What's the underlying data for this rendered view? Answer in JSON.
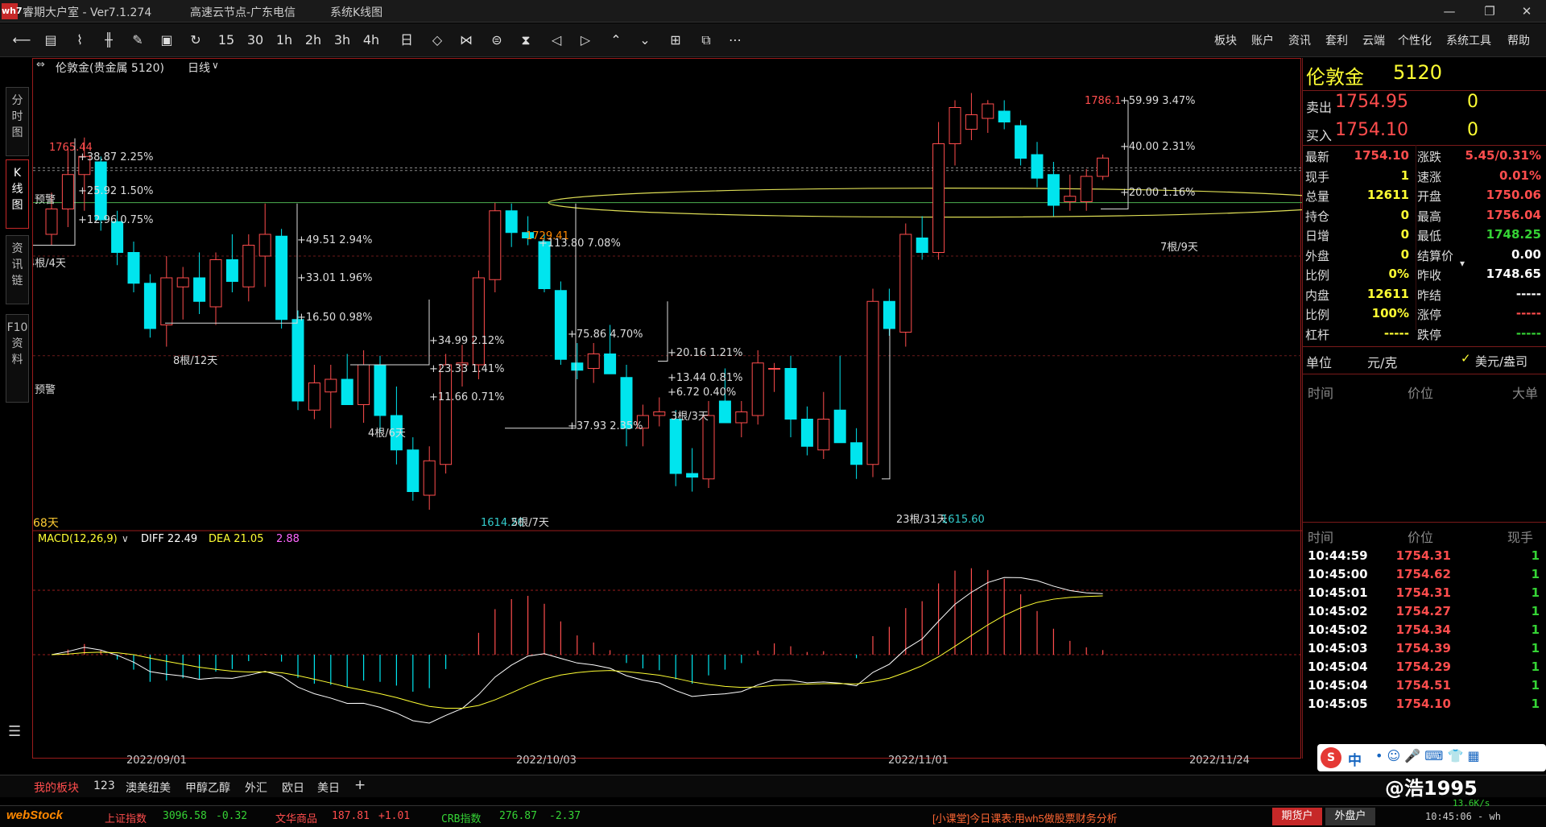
{
  "window": {
    "logo": "wh7",
    "app_title": "睿期大户室  - Ver7.1.274",
    "server": "高速云节点-广东电信",
    "module": "系统K线图",
    "minimize": "—",
    "maximize": "❐",
    "close": "✕"
  },
  "toolbar": {
    "icons": [
      "back-arrow-icon",
      "table-icon",
      "line-chart-icon",
      "kline-icon",
      "draw-icon",
      "save-icon",
      "refresh-icon",
      "15",
      "30",
      "1h",
      "2h",
      "3h",
      "4h",
      "day-icon",
      "diamond-icon",
      "bowtie-icon",
      "layers-icon",
      "hourglass-icon",
      "prev-icon",
      "next-icon",
      "up-icon",
      "down-icon",
      "grid-icon",
      "window-icon",
      "more-icon"
    ],
    "timeframes": [
      "15",
      "30",
      "1h",
      "2h",
      "3h",
      "4h"
    ],
    "menu": [
      "板块",
      "账户",
      "资讯",
      "套利",
      "云端",
      "个性化",
      "系统工具",
      "帮助"
    ]
  },
  "side_tabs": [
    {
      "label": "分\n时\n图",
      "active": false
    },
    {
      "label": "K\n线\n图",
      "active": true
    },
    {
      "label": "资\n讯\n链",
      "active": false
    },
    {
      "label": "F10\n资\n料",
      "active": false
    }
  ],
  "chart": {
    "header_symbol": "伦敦金(贵金属 5120)",
    "period": "日线",
    "period_arrow": "∨",
    "warn1": "预警",
    "warn2": "预警",
    "days_label": "68天",
    "macd_label": "MACD(12,26,9)",
    "macd_arrow": "∨",
    "diff": "DIFF 22.49",
    "dea": "DEA 21.05",
    "macd_val": "2.88",
    "dates": [
      "2022/09/01",
      "2022/10/03",
      "2022/11/01",
      "2022/11/24"
    ],
    "annotations": [
      {
        "text": "1765.44",
        "color": "#ff4d4d"
      },
      {
        "text": "+38.87  2.25%",
        "color": "#ddd"
      },
      {
        "text": "+25.92  1.50%",
        "color": "#ddd"
      },
      {
        "text": "+12.96  0.75%",
        "color": "#ddd"
      },
      {
        "text": "4根/4天",
        "color": "#ddd"
      },
      {
        "text": "+49.51  2.94%",
        "color": "#ddd"
      },
      {
        "text": "+33.01  1.96%",
        "color": "#ddd"
      },
      {
        "text": "+16.50  0.98%",
        "color": "#ddd"
      },
      {
        "text": "8根/12天",
        "color": "#ddd"
      },
      {
        "text": "+34.99  2.12%",
        "color": "#ddd"
      },
      {
        "text": "+23.33  1.41%",
        "color": "#ddd"
      },
      {
        "text": "+11.66  0.71%",
        "color": "#ddd"
      },
      {
        "text": "4根/6天",
        "color": "#ddd"
      },
      {
        "text": "1614.20",
        "color": "#33cccc"
      },
      {
        "text": "5根/7天",
        "color": "#ddd"
      },
      {
        "text": "1729.41",
        "color": "#ff8800"
      },
      {
        "text": "+113.80  7.08%",
        "color": "#ddd"
      },
      {
        "text": "+75.86  4.70%",
        "color": "#ddd"
      },
      {
        "text": "+37.93  2.35%",
        "color": "#ddd"
      },
      {
        "text": "+20.16  1.21%",
        "color": "#ddd"
      },
      {
        "text": "+13.44  0.81%",
        "color": "#ddd"
      },
      {
        "text": "+6.72  0.40%",
        "color": "#ddd"
      },
      {
        "text": "3根/3天",
        "color": "#ddd"
      },
      {
        "text": "23根/31天",
        "color": "#ddd"
      },
      {
        "text": "1615.60",
        "color": "#33cccc"
      },
      {
        "text": "1786.1",
        "color": "#ff4d4d"
      },
      {
        "text": "+59.99  3.47%",
        "color": "#ddd"
      },
      {
        "text": "+40.00  2.31%",
        "color": "#ddd"
      },
      {
        "text": "+20.00  1.16%",
        "color": "#ddd"
      },
      {
        "text": "7根/9天",
        "color": "#ddd"
      }
    ]
  },
  "chart_data": {
    "type": "candlestick",
    "title": "伦敦金 日线",
    "candles": [
      {
        "o": 1712,
        "h": 1735,
        "l": 1706,
        "c": 1726
      },
      {
        "o": 1726,
        "h": 1760,
        "l": 1716,
        "c": 1745
      },
      {
        "o": 1745,
        "h": 1765.44,
        "l": 1725,
        "c": 1755
      },
      {
        "o": 1752,
        "h": 1755,
        "l": 1714,
        "c": 1720
      },
      {
        "o": 1719,
        "h": 1725,
        "l": 1695,
        "c": 1702
      },
      {
        "o": 1702,
        "h": 1708,
        "l": 1680,
        "c": 1685
      },
      {
        "o": 1685,
        "h": 1690,
        "l": 1655,
        "c": 1660
      },
      {
        "o": 1662,
        "h": 1700,
        "l": 1650,
        "c": 1688
      },
      {
        "o": 1683,
        "h": 1694,
        "l": 1665,
        "c": 1688
      },
      {
        "o": 1688,
        "h": 1702,
        "l": 1668,
        "c": 1675
      },
      {
        "o": 1672,
        "h": 1702,
        "l": 1662,
        "c": 1698
      },
      {
        "o": 1698,
        "h": 1712,
        "l": 1680,
        "c": 1686
      },
      {
        "o": 1683,
        "h": 1712,
        "l": 1675,
        "c": 1706
      },
      {
        "o": 1700,
        "h": 1729,
        "l": 1683,
        "c": 1712
      },
      {
        "o": 1711,
        "h": 1715,
        "l": 1660,
        "c": 1665
      },
      {
        "o": 1665,
        "h": 1670,
        "l": 1615,
        "c": 1620
      },
      {
        "o": 1615,
        "h": 1640,
        "l": 1610,
        "c": 1630
      },
      {
        "o": 1625,
        "h": 1640,
        "l": 1605,
        "c": 1632
      },
      {
        "o": 1632,
        "h": 1646,
        "l": 1618,
        "c": 1618
      },
      {
        "o": 1618,
        "h": 1648,
        "l": 1608,
        "c": 1640
      },
      {
        "o": 1640,
        "h": 1645,
        "l": 1603,
        "c": 1612
      },
      {
        "o": 1612,
        "h": 1628,
        "l": 1585,
        "c": 1593
      },
      {
        "o": 1593,
        "h": 1600,
        "l": 1565,
        "c": 1570
      },
      {
        "o": 1568,
        "h": 1595,
        "l": 1560,
        "c": 1587
      },
      {
        "o": 1585,
        "h": 1646,
        "l": 1580,
        "c": 1640
      },
      {
        "o": 1640,
        "h": 1651,
        "l": 1628,
        "c": 1641
      },
      {
        "o": 1640,
        "h": 1692,
        "l": 1632,
        "c": 1688
      },
      {
        "o": 1687,
        "h": 1729.41,
        "l": 1680,
        "c": 1725
      },
      {
        "o": 1725,
        "h": 1729,
        "l": 1705,
        "c": 1713
      },
      {
        "o": 1713,
        "h": 1722,
        "l": 1706,
        "c": 1710
      },
      {
        "o": 1708,
        "h": 1712,
        "l": 1680,
        "c": 1682
      },
      {
        "o": 1681,
        "h": 1686,
        "l": 1640,
        "c": 1643
      },
      {
        "o": 1641,
        "h": 1652,
        "l": 1632,
        "c": 1637
      },
      {
        "o": 1638,
        "h": 1652,
        "l": 1630,
        "c": 1646
      },
      {
        "o": 1646,
        "h": 1662,
        "l": 1640,
        "c": 1635
      },
      {
        "o": 1633,
        "h": 1640,
        "l": 1595,
        "c": 1605
      },
      {
        "o": 1605,
        "h": 1618,
        "l": 1595,
        "c": 1612
      },
      {
        "o": 1612,
        "h": 1622,
        "l": 1606,
        "c": 1614
      },
      {
        "o": 1610,
        "h": 1615,
        "l": 1573,
        "c": 1580
      },
      {
        "o": 1580,
        "h": 1594,
        "l": 1570,
        "c": 1578
      },
      {
        "o": 1577,
        "h": 1620,
        "l": 1572,
        "c": 1612
      },
      {
        "o": 1620,
        "h": 1638,
        "l": 1612,
        "c": 1608
      },
      {
        "o": 1608,
        "h": 1620,
        "l": 1600,
        "c": 1614
      },
      {
        "o": 1612,
        "h": 1648,
        "l": 1607,
        "c": 1641
      },
      {
        "o": 1638,
        "h": 1641,
        "l": 1625,
        "c": 1638
      },
      {
        "o": 1638,
        "h": 1645,
        "l": 1600,
        "c": 1610
      },
      {
        "o": 1610,
        "h": 1617,
        "l": 1590,
        "c": 1595
      },
      {
        "o": 1593,
        "h": 1625,
        "l": 1588,
        "c": 1610
      },
      {
        "o": 1615,
        "h": 1645,
        "l": 1600,
        "c": 1597
      },
      {
        "o": 1597,
        "h": 1605,
        "l": 1577,
        "c": 1585
      },
      {
        "o": 1585,
        "h": 1682,
        "l": 1578,
        "c": 1675
      },
      {
        "o": 1675,
        "h": 1682,
        "l": 1656,
        "c": 1660
      },
      {
        "o": 1658,
        "h": 1718,
        "l": 1650,
        "c": 1712
      },
      {
        "o": 1710,
        "h": 1722,
        "l": 1698,
        "c": 1702
      },
      {
        "o": 1702,
        "h": 1774,
        "l": 1698,
        "c": 1762
      },
      {
        "o": 1762,
        "h": 1786,
        "l": 1750,
        "c": 1782
      },
      {
        "o": 1770,
        "h": 1790,
        "l": 1764,
        "c": 1778
      },
      {
        "o": 1776,
        "h": 1786.1,
        "l": 1768,
        "c": 1784
      },
      {
        "o": 1780,
        "h": 1786,
        "l": 1770,
        "c": 1774
      },
      {
        "o": 1772,
        "h": 1775,
        "l": 1750,
        "c": 1754
      },
      {
        "o": 1756,
        "h": 1763,
        "l": 1738,
        "c": 1743
      },
      {
        "o": 1745,
        "h": 1752,
        "l": 1722,
        "c": 1728
      },
      {
        "o": 1730,
        "h": 1745,
        "l": 1725,
        "c": 1733
      },
      {
        "o": 1730,
        "h": 1748,
        "l": 1725,
        "c": 1744
      },
      {
        "o": 1744,
        "h": 1756.04,
        "l": 1742,
        "c": 1754.1
      }
    ],
    "macd": {
      "diff_last": 22.49,
      "dea_last": 21.05,
      "hist_last": 2.88
    },
    "ylim": [
      1560,
      1800
    ]
  },
  "right_panel": {
    "symbol": "伦敦金",
    "code": "5120",
    "sell_label": "卖出",
    "sell_price": "1754.95",
    "sell_qty": "0",
    "buy_label": "买入",
    "buy_price": "1754.10",
    "buy_qty": "0",
    "stats": [
      {
        "l1": "最新",
        "v1": "1754.10",
        "c1": "red",
        "l2": "涨跌",
        "v2": "5.45/0.31%",
        "c2": "red"
      },
      {
        "l1": "现手",
        "v1": "1",
        "c1": "yellow",
        "l2": "速涨",
        "v2": "0.01%",
        "c2": "red"
      },
      {
        "l1": "总量",
        "v1": "12611",
        "c1": "yellow",
        "l2": "开盘",
        "v2": "1750.06",
        "c2": "red"
      },
      {
        "l1": "持仓",
        "v1": "0",
        "c1": "yellow",
        "l2": "最高",
        "v2": "1756.04",
        "c2": "red"
      },
      {
        "l1": "日增",
        "v1": "0",
        "c1": "yellow",
        "l2": "最低",
        "v2": "1748.25",
        "c2": "green"
      },
      {
        "l1": "外盘",
        "v1": "0",
        "c1": "yellow",
        "l2": "结算价",
        "v2": "0.00",
        "c2": "white"
      },
      {
        "l1": "比例",
        "v1": "0%",
        "c1": "yellow",
        "l2": "昨收",
        "v2": "1748.65",
        "c2": "white"
      },
      {
        "l1": "内盘",
        "v1": "12611",
        "c1": "yellow",
        "l2": "昨结",
        "v2": "-----",
        "c2": "white"
      },
      {
        "l1": "比例",
        "v1": "100%",
        "c1": "yellow",
        "l2": "涨停",
        "v2": "-----",
        "c2": "red"
      },
      {
        "l1": "杠杆",
        "v1": "-----",
        "c1": "yellow",
        "l2": "跌停",
        "v2": "-----",
        "c2": "green"
      }
    ],
    "settle_arrow": "▾",
    "unit_label": "单位",
    "unit_value": "元/克",
    "unit_check": "✓",
    "unit_alt": "美元/盎司",
    "col_time": "时间",
    "col_price": "价位",
    "col_big": "大单",
    "col_time2": "时间",
    "col_price2": "价位",
    "col_qty": "现手",
    "ticks": [
      {
        "t": "10:44:59",
        "p": "1754.31",
        "q": "1"
      },
      {
        "t": "10:45:00",
        "p": "1754.62",
        "q": "1"
      },
      {
        "t": "10:45:01",
        "p": "1754.31",
        "q": "1"
      },
      {
        "t": "10:45:02",
        "p": "1754.27",
        "q": "1"
      },
      {
        "t": "10:45:02",
        "p": "1754.34",
        "q": "1"
      },
      {
        "t": "10:45:03",
        "p": "1754.39",
        "q": "1"
      },
      {
        "t": "10:45:04",
        "p": "1754.29",
        "q": "1"
      },
      {
        "t": "10:45:04",
        "p": "1754.51",
        "q": "1"
      },
      {
        "t": "10:45:05",
        "p": "1754.10",
        "q": "1"
      }
    ]
  },
  "bottom_tabs": [
    "我的板块",
    "123",
    "澳美纽美",
    "甲醇乙醇",
    "外汇",
    "欧日",
    "美日",
    "+"
  ],
  "statusbar": {
    "brand": "webStock",
    "idx1_name": "上证指数",
    "idx1_val": "3096.58",
    "idx1_chg": "-0.32",
    "idx2_name": "文华商品",
    "idx2_val": "187.81",
    "idx2_chg": "+1.01",
    "idx3_name": "CRB指数",
    "idx3_val": "276.87",
    "idx3_chg": "-2.37",
    "news": "[小课堂]今日课表:用wh5做股票财务分析",
    "btn_futures": "期货户",
    "btn_outer": "外盘户",
    "time": "10:45:06 - wh",
    "speed": "13.6K/s",
    "ime": "中",
    "watermark": "@浩1995"
  },
  "colors": {
    "up": "#ff4d4d",
    "down": "#00e5ee",
    "accent": "#c62828",
    "yellow": "#ffff33",
    "green": "#35d335"
  }
}
